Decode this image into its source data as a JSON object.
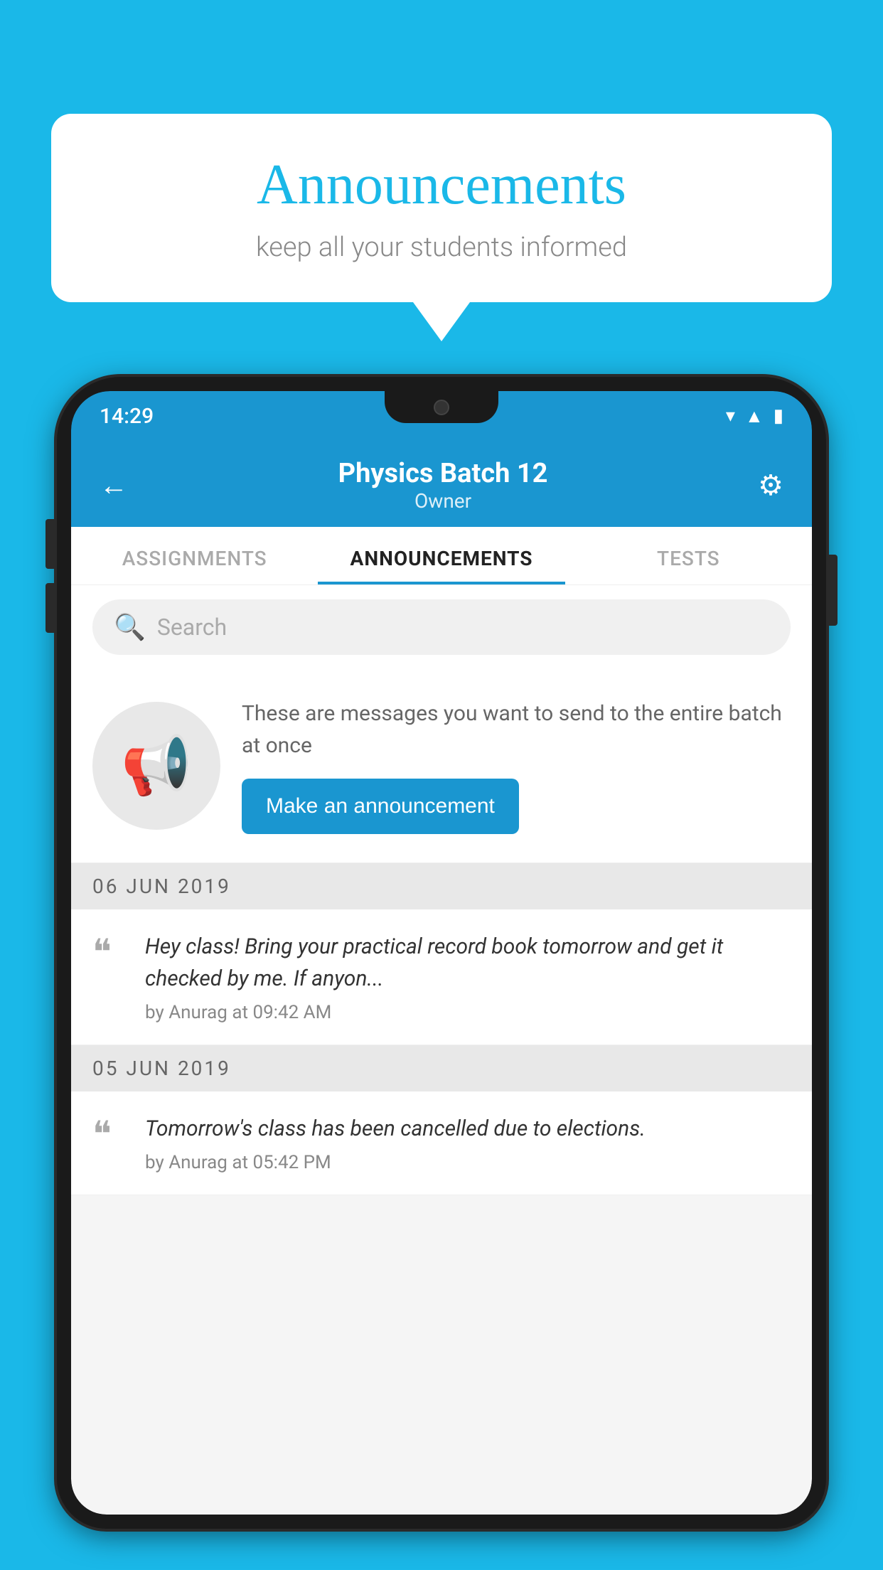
{
  "background_color": "#1ab8e8",
  "speech_bubble": {
    "title": "Announcements",
    "subtitle": "keep all your students informed"
  },
  "phone": {
    "status_bar": {
      "time": "14:29",
      "icons": [
        "▾◂",
        "▲",
        "▮"
      ]
    },
    "header": {
      "title": "Physics Batch 12",
      "subtitle": "Owner",
      "back_label": "←",
      "settings_label": "⚙"
    },
    "tabs": [
      {
        "label": "ASSIGNMENTS",
        "active": false
      },
      {
        "label": "ANNOUNCEMENTS",
        "active": true
      },
      {
        "label": "TESTS",
        "active": false
      },
      {
        "label": "•",
        "active": false
      }
    ],
    "search": {
      "placeholder": "Search"
    },
    "promo": {
      "description": "These are messages you want to send to the entire batch at once",
      "button_label": "Make an announcement"
    },
    "announcements": [
      {
        "date": "06  JUN  2019",
        "text": "Hey class! Bring your practical record book tomorrow and get it checked by me. If anyon...",
        "meta": "by Anurag at 09:42 AM"
      },
      {
        "date": "05  JUN  2019",
        "text": "Tomorrow's class has been cancelled due to elections.",
        "meta": "by Anurag at 05:42 PM"
      }
    ]
  }
}
